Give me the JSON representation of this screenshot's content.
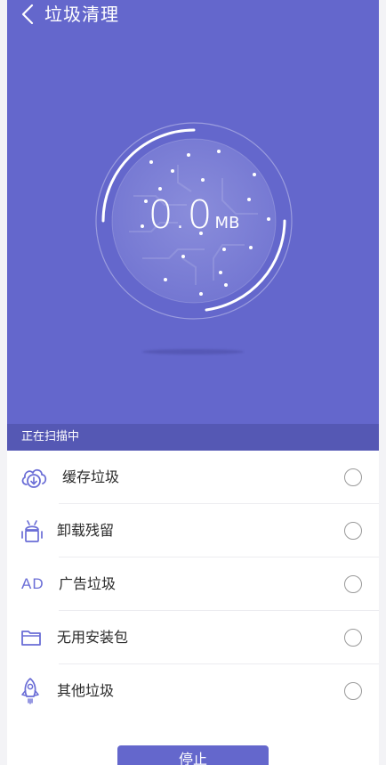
{
  "header": {
    "title": "垃圾清理",
    "back_icon": "chevron-left-icon"
  },
  "gauge": {
    "value": "0.0",
    "unit": "MB",
    "progress": 0
  },
  "status": {
    "text": "正在扫描中"
  },
  "items": [
    {
      "label": "缓存垃圾",
      "icon": "cloud-download-icon"
    },
    {
      "label": "卸载残留",
      "icon": "android-icon"
    },
    {
      "label": "广告垃圾",
      "icon": "ad-icon",
      "icon_text": "AD"
    },
    {
      "label": "无用安装包",
      "icon": "folder-icon"
    },
    {
      "label": "其他垃圾",
      "icon": "rocket-icon"
    }
  ],
  "stop_button": {
    "label": "停止"
  },
  "colors": {
    "primary": "#6467cc",
    "status_bar": "#5558b4",
    "icon": "#6a6dd6"
  }
}
